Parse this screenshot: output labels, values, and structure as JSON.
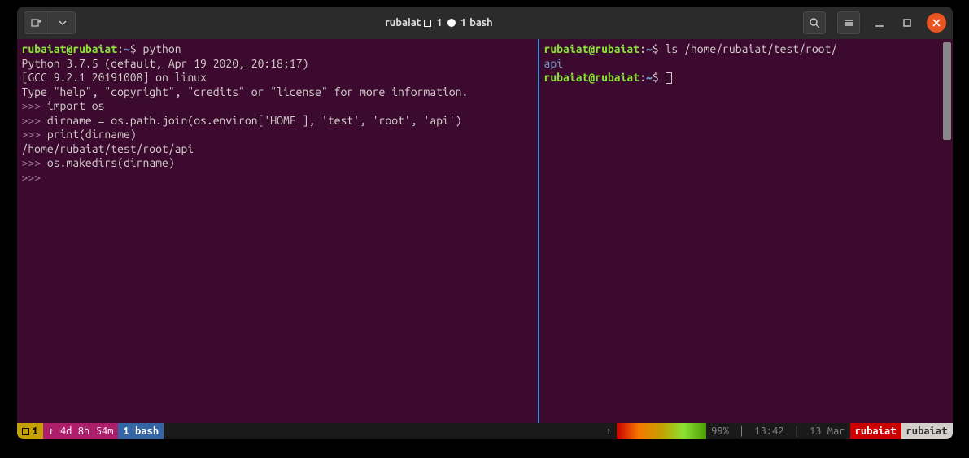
{
  "titlebar": {
    "title_prefix": "rubaiat",
    "title_session_empty": "1",
    "title_session_full": "1",
    "title_suffix": "bash"
  },
  "left_pane": {
    "prompt": {
      "user": "rubaiat",
      "host": "rubaiat",
      "path": "~",
      "symbol": "$"
    },
    "command": "python",
    "python_lines": [
      "Python 3.7.5 (default, Apr 19 2020, 20:18:17)",
      "[GCC 9.2.1 20191008] on linux",
      "Type \"help\", \"copyright\", \"credits\" or \"license\" for more information."
    ],
    "repl": [
      {
        "prompt": ">>>",
        "code": "import os"
      },
      {
        "prompt": ">>>",
        "code": "dirname = os.path.join(os.environ['HOME'], 'test', 'root', 'api')"
      },
      {
        "prompt": ">>>",
        "code": "print(dirname)"
      }
    ],
    "output": "/home/rubaiat/test/root/api",
    "repl2": [
      {
        "prompt": ">>>",
        "code": "os.makedirs(dirname)"
      },
      {
        "prompt": ">>>",
        "code": ""
      }
    ]
  },
  "right_pane": {
    "prompt": {
      "user": "rubaiat",
      "host": "rubaiat",
      "path": "~",
      "symbol": "$"
    },
    "command": "ls /home/rubaiat/test/root/",
    "output": "api",
    "prompt2": {
      "user": "rubaiat",
      "host": "rubaiat",
      "path": "~",
      "symbol": "$"
    }
  },
  "statusbar": {
    "session": "1",
    "uptime": "↑ 4d 8h 54m",
    "window": "1 bash",
    "battery": "99%",
    "time": "13:42",
    "date": "13 Mar",
    "host1": "rubaiat",
    "host2": "rubaiat"
  }
}
